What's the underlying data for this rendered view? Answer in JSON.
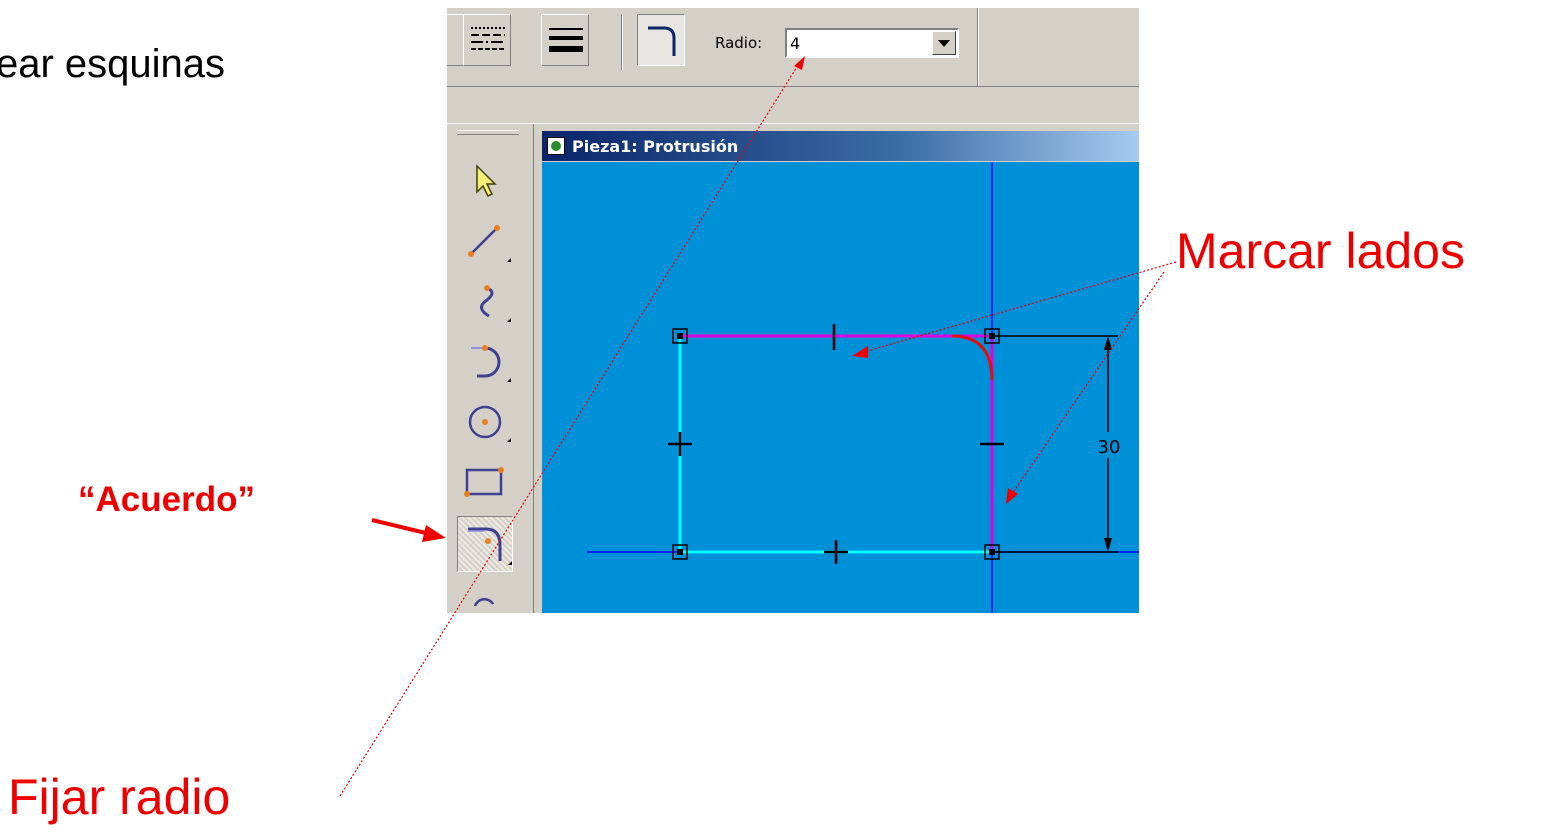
{
  "slide": {
    "title": "ear esquinas",
    "annotation_acuerdo": "“Acuerdo”",
    "annotation_marcar": "Marcar lados",
    "annotation_fijar": "Fijar radio",
    "annotation_color": "#ee0000"
  },
  "toolbar": {
    "radio_label": "Radio:",
    "radio_value": "4"
  },
  "document": {
    "title": "Pieza1: Protrusión",
    "canvas_color": "#0090d8",
    "dimension_label": "30"
  },
  "icons": {
    "select": "arrow-pointer-icon",
    "line": "line-icon",
    "curve": "curve-icon",
    "arc": "arc-icon",
    "circle": "circle-icon",
    "rectangle": "rectangle-icon",
    "fillet": "fillet-icon"
  }
}
